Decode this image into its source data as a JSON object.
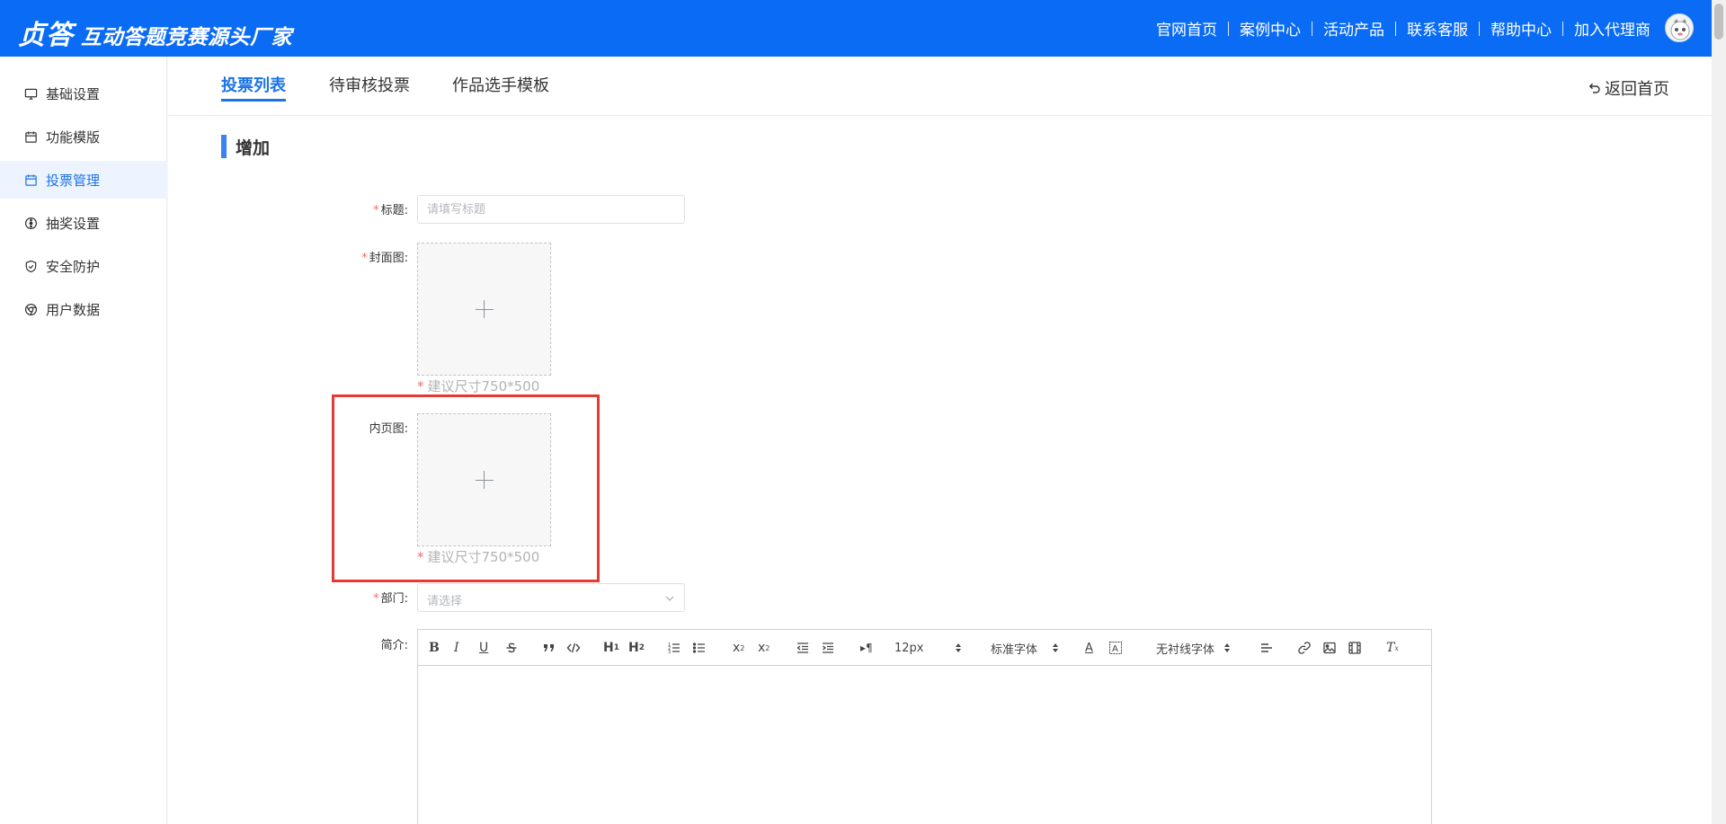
{
  "header": {
    "brand": "贞答",
    "slogan": "互动答题竞赛源头厂家",
    "nav": [
      "官网首页",
      "案例中心",
      "活动产品",
      "联系客服",
      "帮助中心",
      "加入代理商"
    ],
    "bg_color": "#0a6cf5"
  },
  "sidebar": {
    "items": [
      {
        "label": "基础设置",
        "icon": "monitor-icon"
      },
      {
        "label": "功能模版",
        "icon": "calendar-icon"
      },
      {
        "label": "投票管理",
        "icon": "calendar-icon",
        "active": true
      },
      {
        "label": "抽奖设置",
        "icon": "aperture-icon"
      },
      {
        "label": "安全防护",
        "icon": "shield-icon"
      },
      {
        "label": "用户数据",
        "icon": "chrome-icon"
      }
    ],
    "active_color": "#1a73e8"
  },
  "tabs": {
    "items": [
      "投票列表",
      "待审核投票",
      "作品选手模板"
    ],
    "active_index": 0,
    "back_label": "返回首页"
  },
  "form": {
    "section_title": "增加",
    "title_label": "标题:",
    "title_placeholder": "请填写标题",
    "title_value": "",
    "cover_label": "封面图:",
    "cover_hint": "建议尺寸750*500",
    "inner_label": "内页图:",
    "inner_hint": "建议尺寸750*500",
    "dept_label": "部门:",
    "dept_placeholder": "请选择",
    "intro_label": "简介:",
    "required_mark": "*",
    "highlight_color": "#e53935"
  },
  "editor": {
    "buttons": [
      "bold",
      "italic",
      "underline",
      "strike",
      "blockquote",
      "code",
      "h1",
      "h2",
      "ordered-list",
      "bullet-list",
      "subscript",
      "superscript",
      "outdent",
      "indent",
      "direction"
    ],
    "size_value": "12px",
    "font_value": "标准字体",
    "font2_value": "无衬线字体",
    "content": ""
  }
}
